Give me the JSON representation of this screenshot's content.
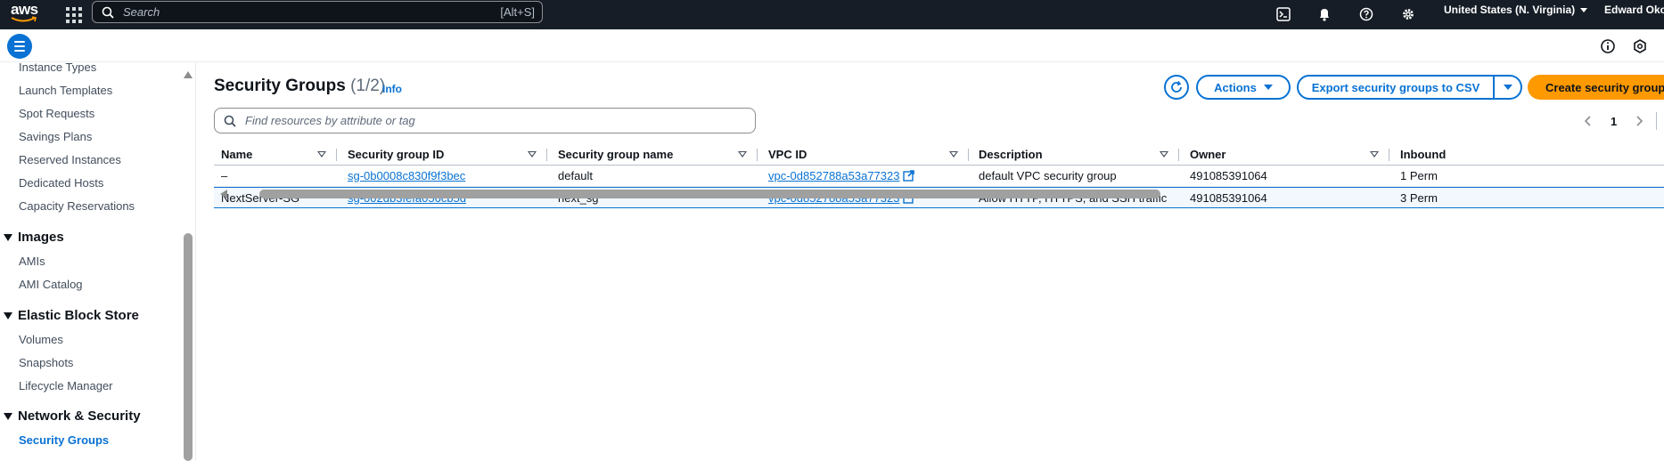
{
  "topnav": {
    "logo_text": "aws",
    "search_placeholder": "Search",
    "search_shortcut": "[Alt+S]",
    "region": "United States (N. Virginia)",
    "user": "Edward Okot",
    "icons": [
      "cloudshell-icon",
      "bell-icon",
      "help-icon",
      "settings-icon"
    ]
  },
  "sidebar": {
    "links_top": [
      "Instance Types",
      "Launch Templates",
      "Spot Requests",
      "Savings Plans",
      "Reserved Instances",
      "Dedicated Hosts",
      "Capacity Reservations"
    ],
    "sections": [
      {
        "title": "Images",
        "items": [
          "AMIs",
          "AMI Catalog"
        ]
      },
      {
        "title": "Elastic Block Store",
        "items": [
          "Volumes",
          "Snapshots",
          "Lifecycle Manager"
        ]
      },
      {
        "title": "Network & Security",
        "items": [
          "Security Groups"
        ]
      }
    ]
  },
  "main": {
    "title": "Security Groups",
    "count": "(1/2)",
    "info": "Info",
    "actions_label": "Actions",
    "export_label": "Export security groups to CSV",
    "create_label": "Create security group",
    "filter_placeholder": "Find resources by attribute or tag",
    "page": "1"
  },
  "table": {
    "columns": [
      "Name",
      "Security group ID",
      "Security group name",
      "VPC ID",
      "Description",
      "Owner",
      "Inbound"
    ],
    "rows": [
      {
        "name": "–",
        "sg_id": "sg-0b0008c830f9f3bec",
        "sg_name": "default",
        "vpc_id": "vpc-0d852788a53a77323",
        "description": "default VPC security group",
        "owner": "491085391064",
        "inbound": "1 Perm"
      },
      {
        "name": "NextServer-SG",
        "sg_id": "sg-002db3fefa056cb5d",
        "sg_name": "next_sg",
        "vpc_id": "vpc-0d852788a53a77323",
        "description": "Allow HTTP, HTTPS, and SSH traffic",
        "owner": "491085391064",
        "inbound": "3 Perm"
      }
    ]
  },
  "colors": {
    "nav_bg": "#161d26",
    "accent": "#0972d3",
    "primary_button": "#ff9900"
  }
}
